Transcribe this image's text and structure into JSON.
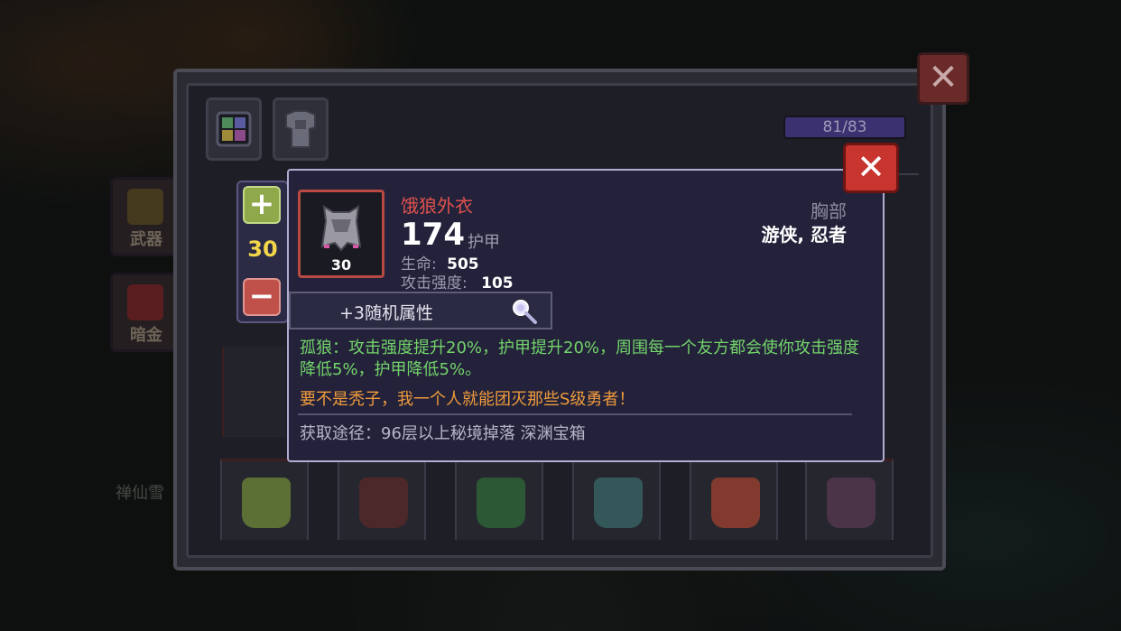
{
  "background": {
    "side_tabs": [
      "武器",
      "暗金"
    ],
    "npc_name": "禅仙雪"
  },
  "inventory": {
    "capacity": "81/83",
    "close_icon": "✕",
    "top_icons": [
      "grid-icon",
      "armor-icon"
    ],
    "equipment_slots": [
      {
        "icon": "green-armor-icon",
        "color": "#6f8a3a"
      },
      {
        "icon": "dark-red-armor-icon",
        "color": "#5a2a2a"
      },
      {
        "icon": "green-cloak-icon",
        "color": "#2f6a3a"
      },
      {
        "icon": "teal-armor-icon",
        "color": "#3a6a6a"
      },
      {
        "icon": "red-skull-armor-icon",
        "color": "#a0422e"
      },
      {
        "icon": "purple-armor-icon",
        "color": "#5a3a52"
      }
    ]
  },
  "quantity": {
    "plus": "+",
    "value": "30",
    "minus": "−"
  },
  "item": {
    "name": "饿狼外衣",
    "armor_value": "174",
    "armor_label": "护甲",
    "slot_type": "胸部",
    "classes": "游侠, 忍者",
    "count": "30",
    "stats": [
      {
        "label": "生命:",
        "value": "505"
      },
      {
        "label": "攻击强度:",
        "value": "105"
      }
    ],
    "random_attributes": "+3随机属性",
    "effect_text": "孤狼：攻击强度提升20%，护甲提升20%，周围每一个友方都会使你攻击强度降低5%，护甲降低5%。",
    "flavor_text": "要不是秃子，我一个人就能团灭那些S级勇者！",
    "source_text": "获取途径：96层以上秘境掉落 深渊宝箱",
    "close_icon": "✕"
  },
  "colors": {
    "item_name": "#e0524d",
    "effect": "#73d46a",
    "flavor": "#ee9a3c",
    "qty_value": "#f2d64a"
  }
}
